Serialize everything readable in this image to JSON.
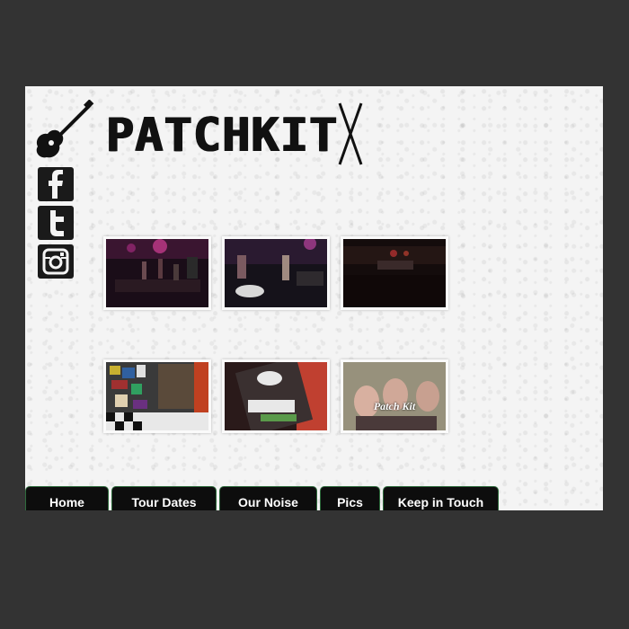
{
  "brand": {
    "name": "PATCHKIT",
    "guitar_icon": "guitar-icon",
    "sticks_icon": "drumsticks-icon"
  },
  "social": [
    {
      "icon": "facebook-icon",
      "glyph": "f"
    },
    {
      "icon": "twitter-icon",
      "glyph": "t"
    },
    {
      "icon": "instagram-icon",
      "glyph": "ig"
    }
  ],
  "gallery": {
    "photos": [
      {
        "name": "photo-stage-1"
      },
      {
        "name": "photo-stage-2"
      },
      {
        "name": "photo-stage-3"
      },
      {
        "name": "photo-stickers"
      },
      {
        "name": "photo-setlist"
      },
      {
        "name": "photo-band",
        "caption": "Patch Kit"
      }
    ]
  },
  "nav": {
    "tabs": [
      {
        "label": "Home"
      },
      {
        "label": "Tour Dates"
      },
      {
        "label": "Our Noise"
      },
      {
        "label": "Pics"
      },
      {
        "label": "Keep in Touch"
      }
    ]
  },
  "colors": {
    "background": "#333333",
    "page": "#f4f4f4",
    "nav_tab": "#0d0d0d",
    "nav_border": "#2e6b3c"
  }
}
